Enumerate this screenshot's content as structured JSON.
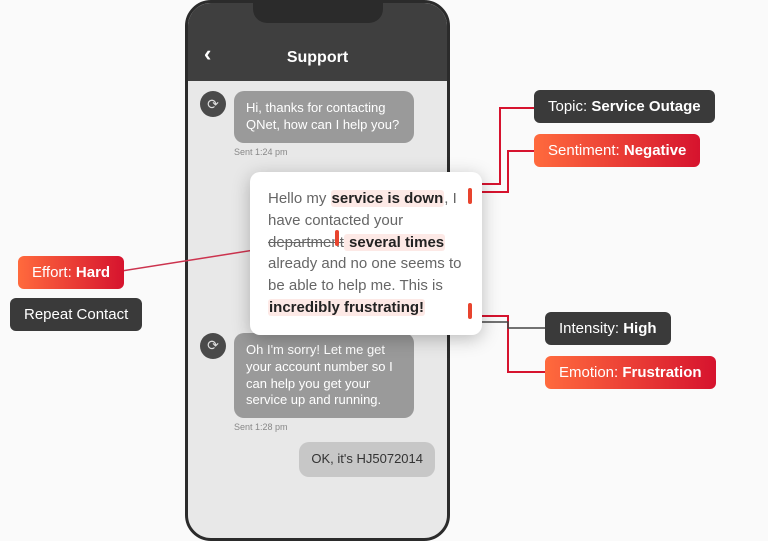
{
  "header": {
    "title": "Support"
  },
  "messages": {
    "agent1": "Hi, thanks for contacting QNet, how can I help you?",
    "ts1": "Sent 1:24 pm",
    "agent2": "Oh I'm sorry! Let me get your account number so I can help you get your service up and running.",
    "ts2": "Sent 1:28 pm",
    "user_partial": "OK, it's HJ5072014"
  },
  "card": {
    "pre1": "Hello my ",
    "hl1": "service is down",
    "post1": ", I have contacted your ",
    "strike": "department",
    "hl2": " several times",
    "mid": " already and no one seems to be able to help me. This is ",
    "hl3": "incredibly frustrating!"
  },
  "tags": {
    "topic": {
      "label": "Topic: ",
      "value": "Service Outage"
    },
    "sentiment": {
      "label": "Sentiment: ",
      "value": "Negative"
    },
    "effort": {
      "label": "Effort: ",
      "value": "Hard"
    },
    "repeat": {
      "label": "Repeat Contact",
      "value": ""
    },
    "intensity": {
      "label": "Intensity: ",
      "value": "High"
    },
    "emotion": {
      "label": "Emotion: ",
      "value": "Frustration"
    }
  }
}
